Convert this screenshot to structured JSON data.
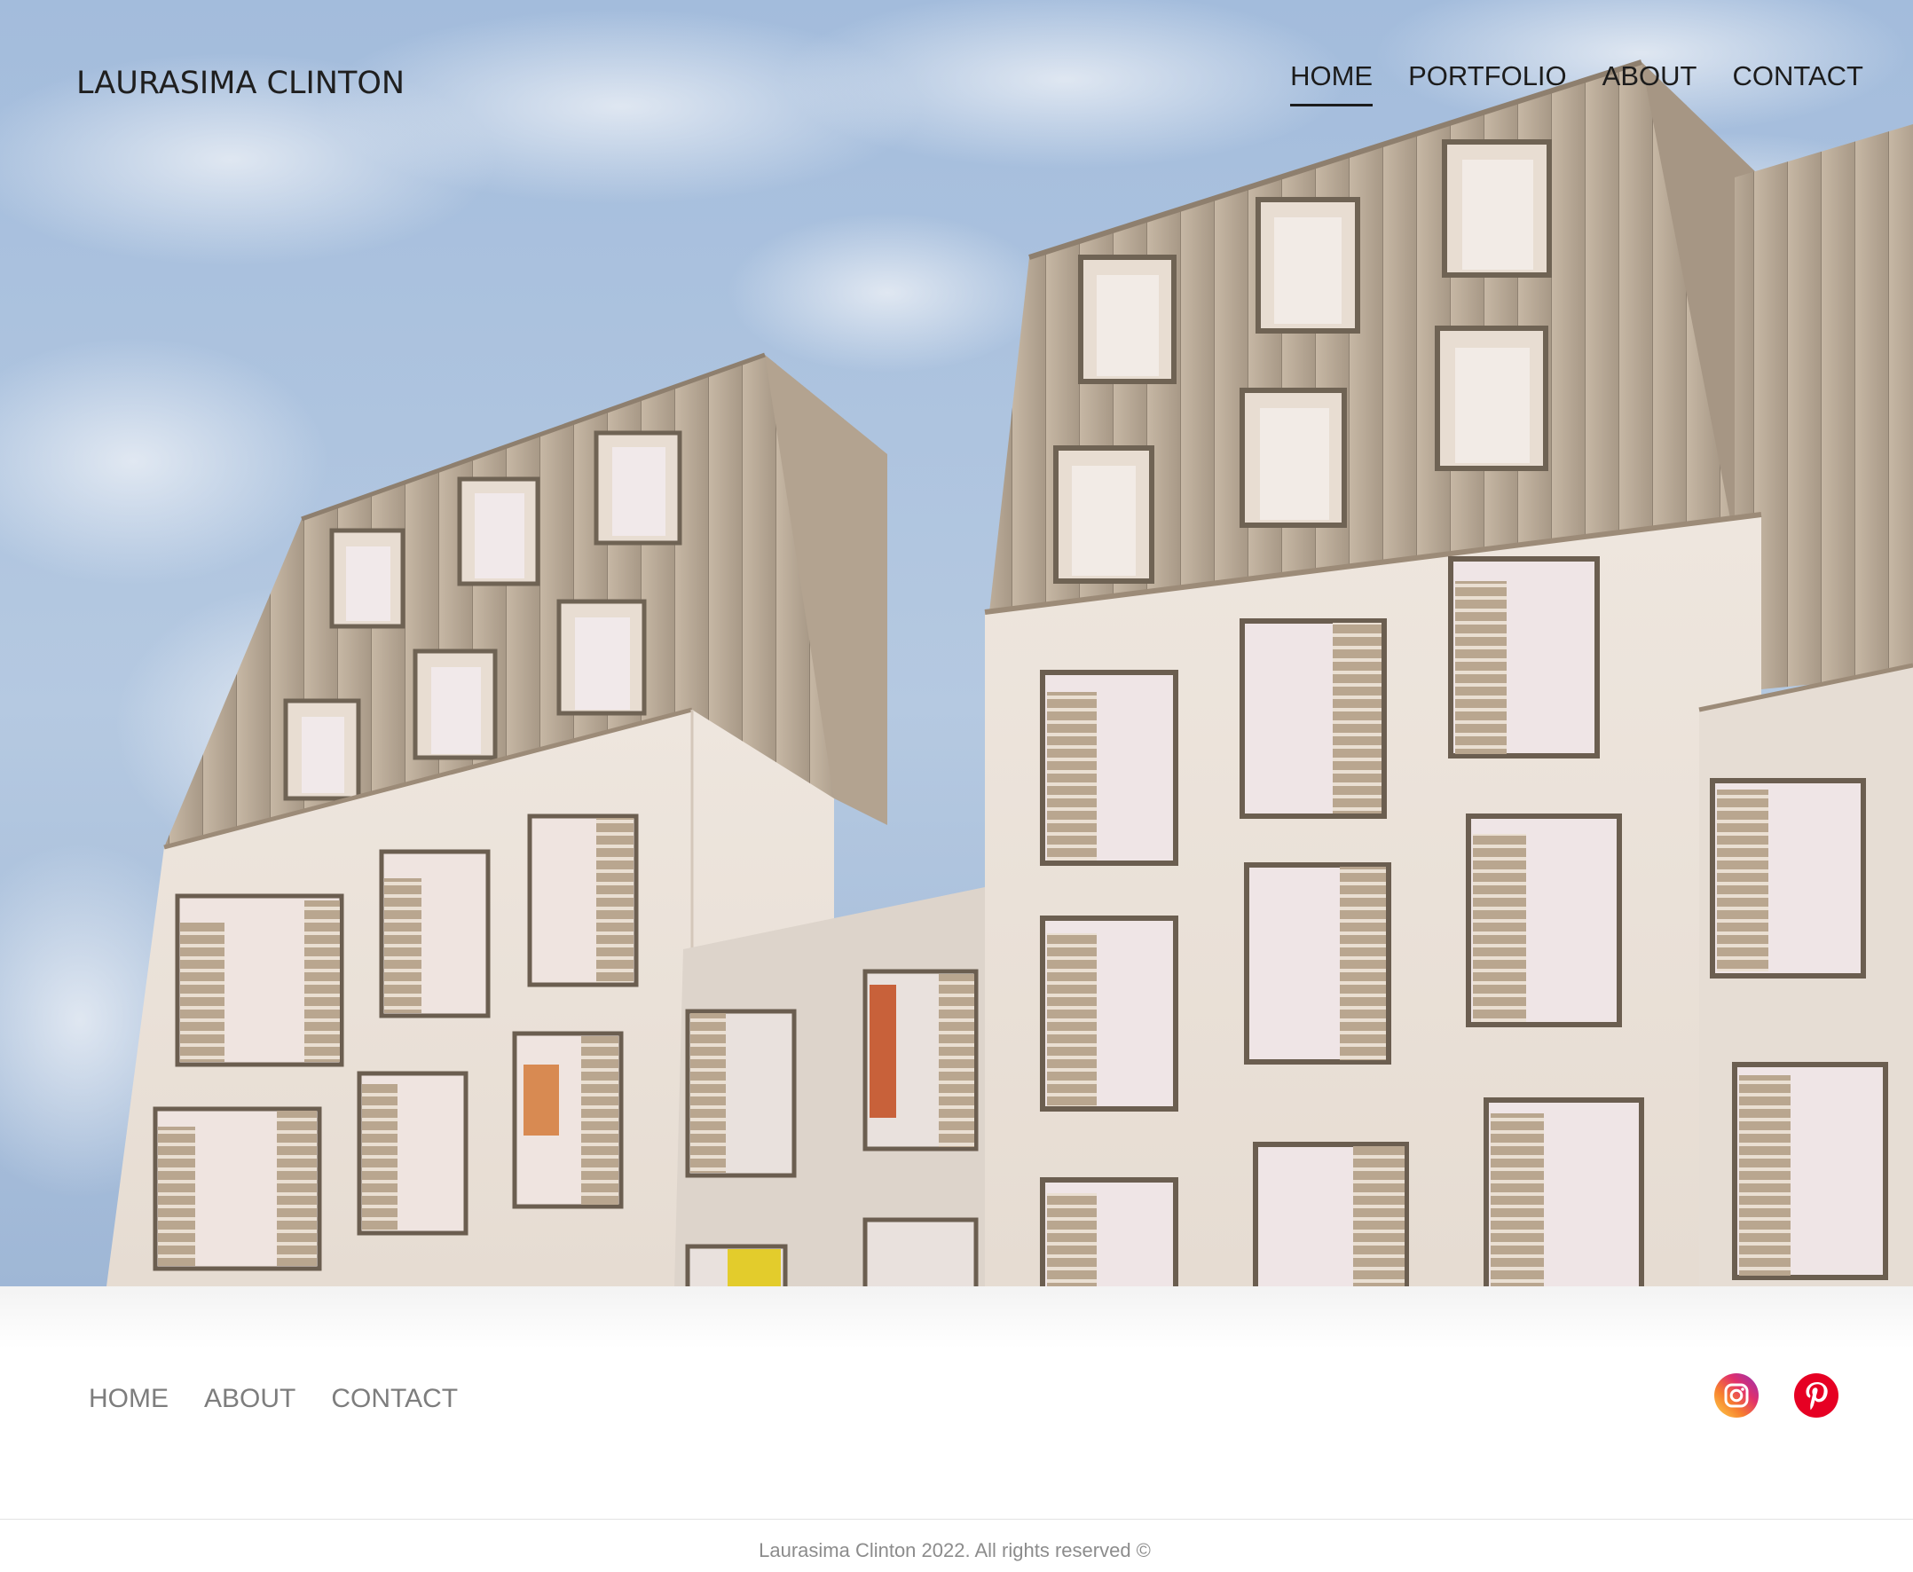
{
  "brand": {
    "name": "LAURASIMA CLINTON"
  },
  "header_nav": [
    {
      "label": "HOME",
      "active": true
    },
    {
      "label": "PORTFOLIO",
      "active": false
    },
    {
      "label": "ABOUT",
      "active": false
    },
    {
      "label": "CONTACT",
      "active": false
    }
  ],
  "hero": {
    "image": "building-facade-photo"
  },
  "footer": {
    "nav": [
      {
        "label": "HOME"
      },
      {
        "label": "ABOUT"
      },
      {
        "label": "CONTACT"
      }
    ],
    "social": [
      {
        "icon": "instagram-icon",
        "color": "#e1306c"
      },
      {
        "icon": "pinterest-icon",
        "color": "#e60023"
      }
    ],
    "copyright": "Laurasima Clinton 2022. All rights reserved ©"
  },
  "colors": {
    "text_dark": "#1c1c1c",
    "footer_link": "#7d7d7d",
    "sky": "#a9c2df",
    "facade": "#e9dfd6",
    "roof": "#b7a896"
  }
}
